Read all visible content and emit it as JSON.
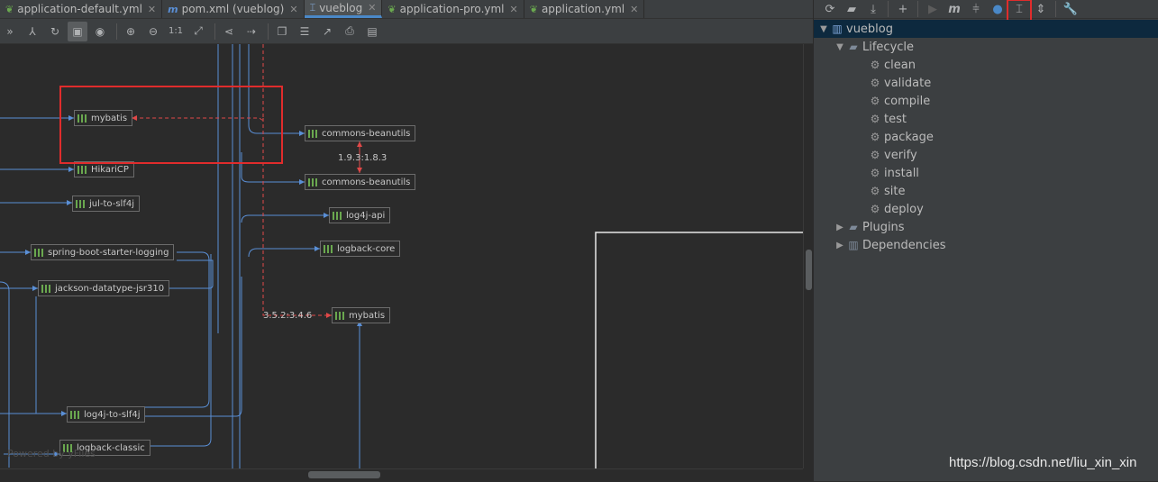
{
  "tabs": [
    {
      "label": "application-default.yml",
      "icon": "spring-leaf-icon"
    },
    {
      "label": "pom.xml (vueblog)",
      "icon": "maven-m-icon"
    },
    {
      "label": "vueblog",
      "icon": "diagram-icon"
    },
    {
      "label": "application-pro.yml",
      "icon": "spring-leaf-icon"
    },
    {
      "label": "application.yml",
      "icon": "spring-leaf-icon"
    }
  ],
  "diagram": {
    "nodes": [
      {
        "label": "mybatis"
      },
      {
        "label": "commons-beanutils"
      },
      {
        "label": "HikariCP"
      },
      {
        "label": "commons-beanutils"
      },
      {
        "label": "jul-to-slf4j"
      },
      {
        "label": "log4j-api"
      },
      {
        "label": "spring-boot-starter-logging"
      },
      {
        "label": "logback-core"
      },
      {
        "label": "jackson-datatype-jsr310"
      },
      {
        "label": "mybatis"
      },
      {
        "label": "log4j-to-slf4j"
      },
      {
        "label": "logback-classic"
      }
    ],
    "edge_labels": [
      "1.9.3:1.8.3",
      "3.5.2:3.4.6"
    ],
    "watermark": "Powered by yFiles"
  },
  "maven": {
    "project": "vueblog",
    "lifecycle_label": "Lifecycle",
    "lifecycle": [
      "clean",
      "validate",
      "compile",
      "test",
      "package",
      "verify",
      "install",
      "site",
      "deploy"
    ],
    "plugins_label": "Plugins",
    "dependencies_label": "Dependencies"
  },
  "csdn_watermark": "https://blog.csdn.net/liu_xin_xin",
  "colors": {
    "accent": "#4a88c7",
    "highlight": "#e02c2c",
    "edge_blue": "#5a8fd6",
    "edge_red": "#e04848"
  }
}
